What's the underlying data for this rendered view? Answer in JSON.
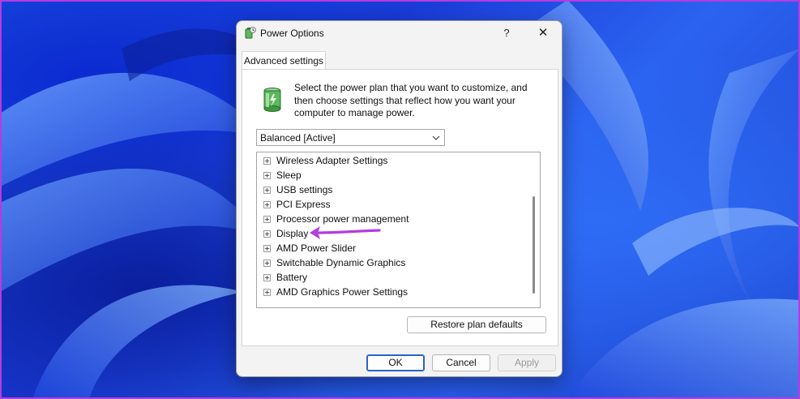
{
  "window": {
    "title": "Power Options",
    "help_label": "?",
    "close_label": "✕"
  },
  "tabs": [
    {
      "label": "Advanced settings",
      "selected": true
    }
  ],
  "description": "Select the power plan that you want to customize, and then choose settings that reflect how you want your computer to manage power.",
  "plan_select": {
    "value": "Balanced [Active]"
  },
  "settings_tree": [
    {
      "label": "Wireless Adapter Settings"
    },
    {
      "label": "Sleep"
    },
    {
      "label": "USB settings"
    },
    {
      "label": "PCI Express"
    },
    {
      "label": "Processor power management"
    },
    {
      "label": "Display"
    },
    {
      "label": "AMD Power Slider"
    },
    {
      "label": "Switchable Dynamic Graphics"
    },
    {
      "label": "Battery"
    },
    {
      "label": "AMD Graphics Power Settings"
    }
  ],
  "buttons": {
    "restore": "Restore plan defaults",
    "ok": "OK",
    "cancel": "Cancel",
    "apply": "Apply"
  },
  "colors": {
    "annotation_arrow": "#b43ce0",
    "accent": "#2b62c9"
  }
}
